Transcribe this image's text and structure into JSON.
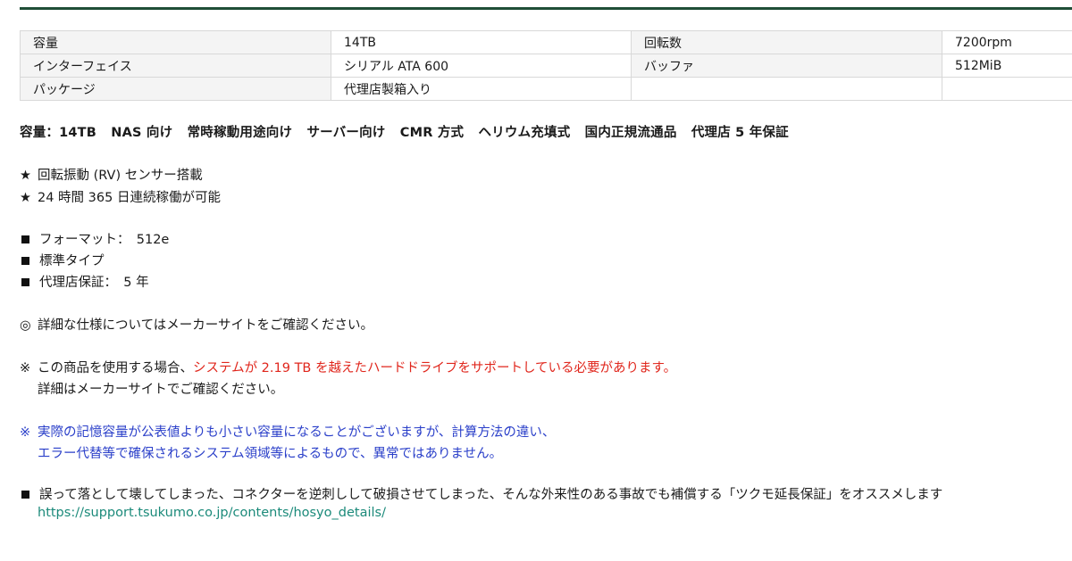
{
  "specs": {
    "rows": [
      {
        "k1": "容量",
        "v1": "14TB",
        "k2": "回転数",
        "v2": "7200rpm"
      },
      {
        "k1": "インターフェイス",
        "v1": "シリアル ATA 600",
        "k2": "バッファ",
        "v2": "512MiB"
      },
      {
        "k1": "パッケージ",
        "v1": "代理店製箱入り",
        "k2": "",
        "v2": ""
      }
    ]
  },
  "features": [
    "容量：14TB",
    "NAS 向け",
    "常時稼動用途向け",
    "サーバー向け",
    "CMR 方式",
    "ヘリウム充填式",
    "国内正規流通品",
    "代理店 5 年保証"
  ],
  "stars": {
    "mark": "★",
    "items": [
      "回転振動 (RV) センサー搭載",
      "24 時間 365 日連続稼働が可能"
    ]
  },
  "squares": [
    "フォーマット：　512e",
    "標準タイプ",
    "代理店保証：　5 年"
  ],
  "notice_detail": {
    "mark": "◎",
    "text": "詳細な仕様についてはメーカーサイトをご確認ください。"
  },
  "notice_support": {
    "mark": "※",
    "text_before": "この商品を使用する場合、",
    "text_red": "システムが 2.19 TB を越えたハードドライブをサポートしている必要があります。",
    "line2": "詳細はメーカーサイトでご確認ください。",
    "accent_color": "#e0261c"
  },
  "notice_capacity": {
    "mark": "※",
    "line1": "実際の記憶容量が公表値よりも小さい容量になることがございますが、計算方法の違い、",
    "line2": "エラー代替等で確保されるシステム領域等によるもので、異常ではありません。",
    "color": "#2a3fc9"
  },
  "warranty": {
    "text": "誤って落として壊してしまった、コネクターを逆刺しして破損させてしまった、そんな外来性のある事故でも補償する「ツクモ延長保証」をオススメします",
    "link": "https://support.tsukumo.co.jp/contents/hosyo_details/"
  }
}
